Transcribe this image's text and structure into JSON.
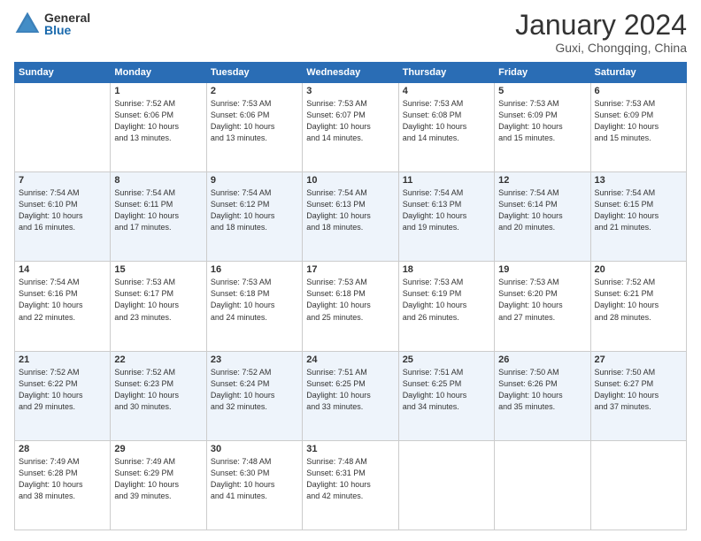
{
  "logo": {
    "general": "General",
    "blue": "Blue"
  },
  "header": {
    "month": "January 2024",
    "location": "Guxi, Chongqing, China"
  },
  "weekdays": [
    "Sunday",
    "Monday",
    "Tuesday",
    "Wednesday",
    "Thursday",
    "Friday",
    "Saturday"
  ],
  "weeks": [
    [
      {
        "day": "",
        "info": ""
      },
      {
        "day": "1",
        "info": "Sunrise: 7:52 AM\nSunset: 6:06 PM\nDaylight: 10 hours\nand 13 minutes."
      },
      {
        "day": "2",
        "info": "Sunrise: 7:53 AM\nSunset: 6:06 PM\nDaylight: 10 hours\nand 13 minutes."
      },
      {
        "day": "3",
        "info": "Sunrise: 7:53 AM\nSunset: 6:07 PM\nDaylight: 10 hours\nand 14 minutes."
      },
      {
        "day": "4",
        "info": "Sunrise: 7:53 AM\nSunset: 6:08 PM\nDaylight: 10 hours\nand 14 minutes."
      },
      {
        "day": "5",
        "info": "Sunrise: 7:53 AM\nSunset: 6:09 PM\nDaylight: 10 hours\nand 15 minutes."
      },
      {
        "day": "6",
        "info": "Sunrise: 7:53 AM\nSunset: 6:09 PM\nDaylight: 10 hours\nand 15 minutes."
      }
    ],
    [
      {
        "day": "7",
        "info": "Sunrise: 7:54 AM\nSunset: 6:10 PM\nDaylight: 10 hours\nand 16 minutes."
      },
      {
        "day": "8",
        "info": "Sunrise: 7:54 AM\nSunset: 6:11 PM\nDaylight: 10 hours\nand 17 minutes."
      },
      {
        "day": "9",
        "info": "Sunrise: 7:54 AM\nSunset: 6:12 PM\nDaylight: 10 hours\nand 18 minutes."
      },
      {
        "day": "10",
        "info": "Sunrise: 7:54 AM\nSunset: 6:13 PM\nDaylight: 10 hours\nand 18 minutes."
      },
      {
        "day": "11",
        "info": "Sunrise: 7:54 AM\nSunset: 6:13 PM\nDaylight: 10 hours\nand 19 minutes."
      },
      {
        "day": "12",
        "info": "Sunrise: 7:54 AM\nSunset: 6:14 PM\nDaylight: 10 hours\nand 20 minutes."
      },
      {
        "day": "13",
        "info": "Sunrise: 7:54 AM\nSunset: 6:15 PM\nDaylight: 10 hours\nand 21 minutes."
      }
    ],
    [
      {
        "day": "14",
        "info": "Sunrise: 7:54 AM\nSunset: 6:16 PM\nDaylight: 10 hours\nand 22 minutes."
      },
      {
        "day": "15",
        "info": "Sunrise: 7:53 AM\nSunset: 6:17 PM\nDaylight: 10 hours\nand 23 minutes."
      },
      {
        "day": "16",
        "info": "Sunrise: 7:53 AM\nSunset: 6:18 PM\nDaylight: 10 hours\nand 24 minutes."
      },
      {
        "day": "17",
        "info": "Sunrise: 7:53 AM\nSunset: 6:18 PM\nDaylight: 10 hours\nand 25 minutes."
      },
      {
        "day": "18",
        "info": "Sunrise: 7:53 AM\nSunset: 6:19 PM\nDaylight: 10 hours\nand 26 minutes."
      },
      {
        "day": "19",
        "info": "Sunrise: 7:53 AM\nSunset: 6:20 PM\nDaylight: 10 hours\nand 27 minutes."
      },
      {
        "day": "20",
        "info": "Sunrise: 7:52 AM\nSunset: 6:21 PM\nDaylight: 10 hours\nand 28 minutes."
      }
    ],
    [
      {
        "day": "21",
        "info": "Sunrise: 7:52 AM\nSunset: 6:22 PM\nDaylight: 10 hours\nand 29 minutes."
      },
      {
        "day": "22",
        "info": "Sunrise: 7:52 AM\nSunset: 6:23 PM\nDaylight: 10 hours\nand 30 minutes."
      },
      {
        "day": "23",
        "info": "Sunrise: 7:52 AM\nSunset: 6:24 PM\nDaylight: 10 hours\nand 32 minutes."
      },
      {
        "day": "24",
        "info": "Sunrise: 7:51 AM\nSunset: 6:25 PM\nDaylight: 10 hours\nand 33 minutes."
      },
      {
        "day": "25",
        "info": "Sunrise: 7:51 AM\nSunset: 6:25 PM\nDaylight: 10 hours\nand 34 minutes."
      },
      {
        "day": "26",
        "info": "Sunrise: 7:50 AM\nSunset: 6:26 PM\nDaylight: 10 hours\nand 35 minutes."
      },
      {
        "day": "27",
        "info": "Sunrise: 7:50 AM\nSunset: 6:27 PM\nDaylight: 10 hours\nand 37 minutes."
      }
    ],
    [
      {
        "day": "28",
        "info": "Sunrise: 7:49 AM\nSunset: 6:28 PM\nDaylight: 10 hours\nand 38 minutes."
      },
      {
        "day": "29",
        "info": "Sunrise: 7:49 AM\nSunset: 6:29 PM\nDaylight: 10 hours\nand 39 minutes."
      },
      {
        "day": "30",
        "info": "Sunrise: 7:48 AM\nSunset: 6:30 PM\nDaylight: 10 hours\nand 41 minutes."
      },
      {
        "day": "31",
        "info": "Sunrise: 7:48 AM\nSunset: 6:31 PM\nDaylight: 10 hours\nand 42 minutes."
      },
      {
        "day": "",
        "info": ""
      },
      {
        "day": "",
        "info": ""
      },
      {
        "day": "",
        "info": ""
      }
    ]
  ]
}
